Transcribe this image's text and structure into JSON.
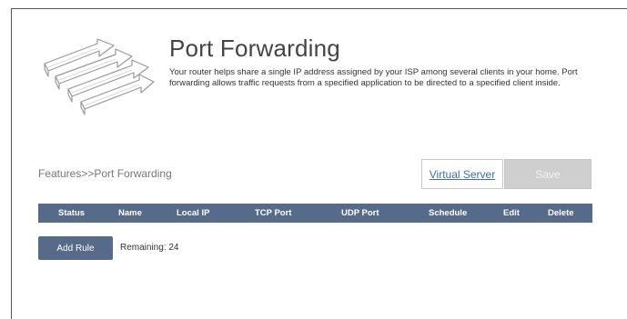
{
  "page": {
    "title": "Port Forwarding",
    "description": "Your router helps share a single IP address assigned by your ISP among several clients in your home. Port forwarding allows traffic requests from a specified application to be directed to a specified client inside."
  },
  "breadcrumb": "Features>>Port Forwarding",
  "actions": {
    "virtual_server_label": "Virtual Server",
    "save_label": "Save"
  },
  "table": {
    "columns": [
      "Status",
      "Name",
      "Local IP",
      "TCP Port",
      "UDP Port",
      "Schedule",
      "Edit",
      "Delete"
    ]
  },
  "footer": {
    "add_rule_label": "Add Rule",
    "remaining_label": "Remaining:",
    "remaining_count": "24"
  },
  "icons": {
    "hero": "port-forward-arrows-icon"
  },
  "colors": {
    "header_bar": "#566b8a",
    "link": "#3b6fb0",
    "save_disabled": "#cfcfcf"
  }
}
